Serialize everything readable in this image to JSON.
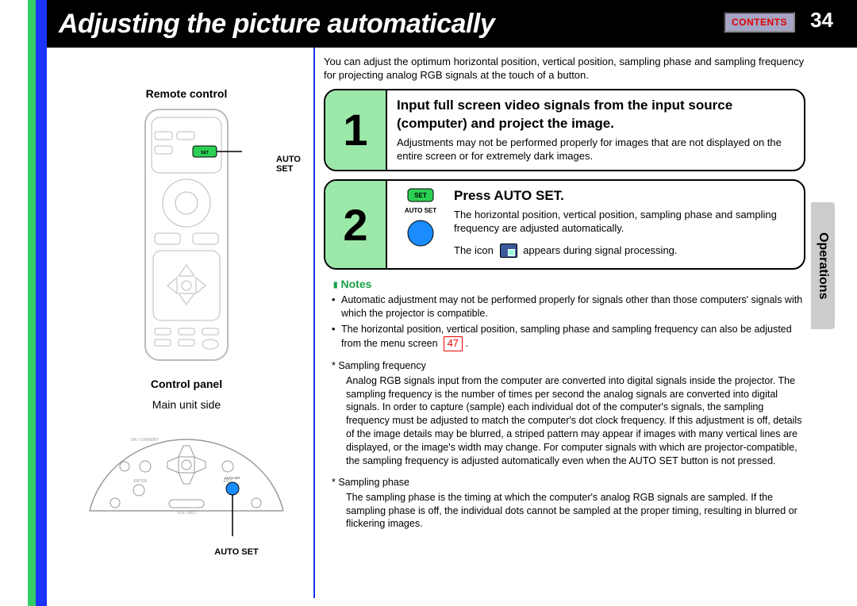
{
  "page": {
    "title": "Adjusting the picture automatically",
    "contents_button": "CONTENTS",
    "page_number": "34",
    "side_tab": "Operations"
  },
  "left": {
    "remote_label": "Remote control",
    "remote_callout": "AUTO SET",
    "panel_label": "Control panel",
    "panel_sub": "Main unit side",
    "panel_callout": "AUTO SET"
  },
  "intro": "You can adjust the optimum horizontal position, vertical position, sampling phase and sampling frequency for projecting analog RGB signals at the touch of a button.",
  "steps": [
    {
      "num": "1",
      "title": "Input full screen video signals from the input source (computer) and project the image.",
      "body": "Adjustments may not be performed properly for images that are not displayed on the entire screen or for extremely dark images."
    },
    {
      "num": "2",
      "title": "Press AUTO SET.",
      "body_a": "The horizontal position, vertical position, sampling phase and sampling frequency are adjusted automatically.",
      "body_b_pre": "The icon",
      "body_b_post": "appears during signal processing.",
      "button_label_small": "SET",
      "button_label": "AUTO SET"
    }
  ],
  "notes_heading": "Notes",
  "notes": [
    "Automatic adjustment may not be performed properly for signals other than those computers' signals with which the projector is compatible.",
    "The horizontal position, vertical position, sampling phase and sampling frequency can also be adjusted from the menu screen"
  ],
  "page_ref": "47",
  "star_items": [
    {
      "label": "Sampling frequency",
      "text": "Analog RGB signals input from the computer are converted into digital signals inside the projector. The sampling frequency is the number of times per second the analog signals are converted into digital signals. In order to capture (sample) each individual dot of the computer's signals, the sampling frequency must be adjusted to match the computer's dot clock frequency. If this adjustment is off, details of the image details may be blurred, a striped pattern may appear if images with many vertical lines are displayed, or the image's width may change. For computer signals with which are projector-compatible, the sampling frequency is adjusted automatically even when the AUTO SET button is not pressed."
    },
    {
      "label": "Sampling phase",
      "text": "The sampling phase is the timing at which the computer's analog RGB signals are sampled. If the sampling phase is off, the individual dots cannot be sampled at the proper timing, resulting in blurred or flickering images."
    }
  ]
}
